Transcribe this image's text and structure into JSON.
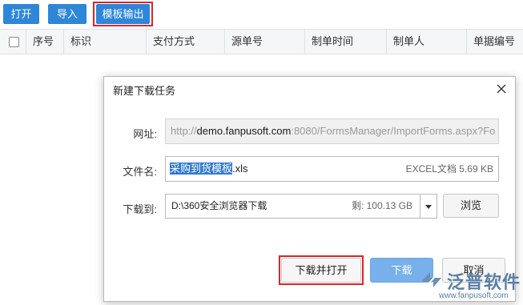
{
  "toolbar": {
    "open_label": "打开",
    "import_label": "导入",
    "export_label": "模板输出"
  },
  "table": {
    "columns": [
      "序号",
      "标识",
      "支付方式",
      "源单号",
      "制单时间",
      "制单人",
      "单据编号"
    ]
  },
  "dialog": {
    "title": "新建下载任务",
    "url_label": "网址:",
    "url_prefix": "http://",
    "url_host": "demo.fanpusoft.com",
    "url_rest": ":8080/FormsManager/ImportForms.aspx?Fo",
    "filename_label": "文件名:",
    "filename_selected": "采购到货模板",
    "filename_ext": ".xls",
    "file_meta": "EXCEL文档 5.69 KB",
    "saveto_label": "下载到:",
    "saveto_path": "D:\\360安全浏览器下载",
    "free_space": "剩: 100.13 GB",
    "browse_label": "浏览",
    "download_open_label": "下载并打开",
    "download_label": "下载",
    "cancel_label": "取消"
  },
  "watermark": {
    "brand": "泛普软件",
    "url": "www.fanpusoft.com"
  },
  "colors": {
    "toolbar_button": "#2e86d9",
    "highlight_frame": "#e02424",
    "selection": "#2f79d0",
    "download_button": "#77b0ea"
  }
}
